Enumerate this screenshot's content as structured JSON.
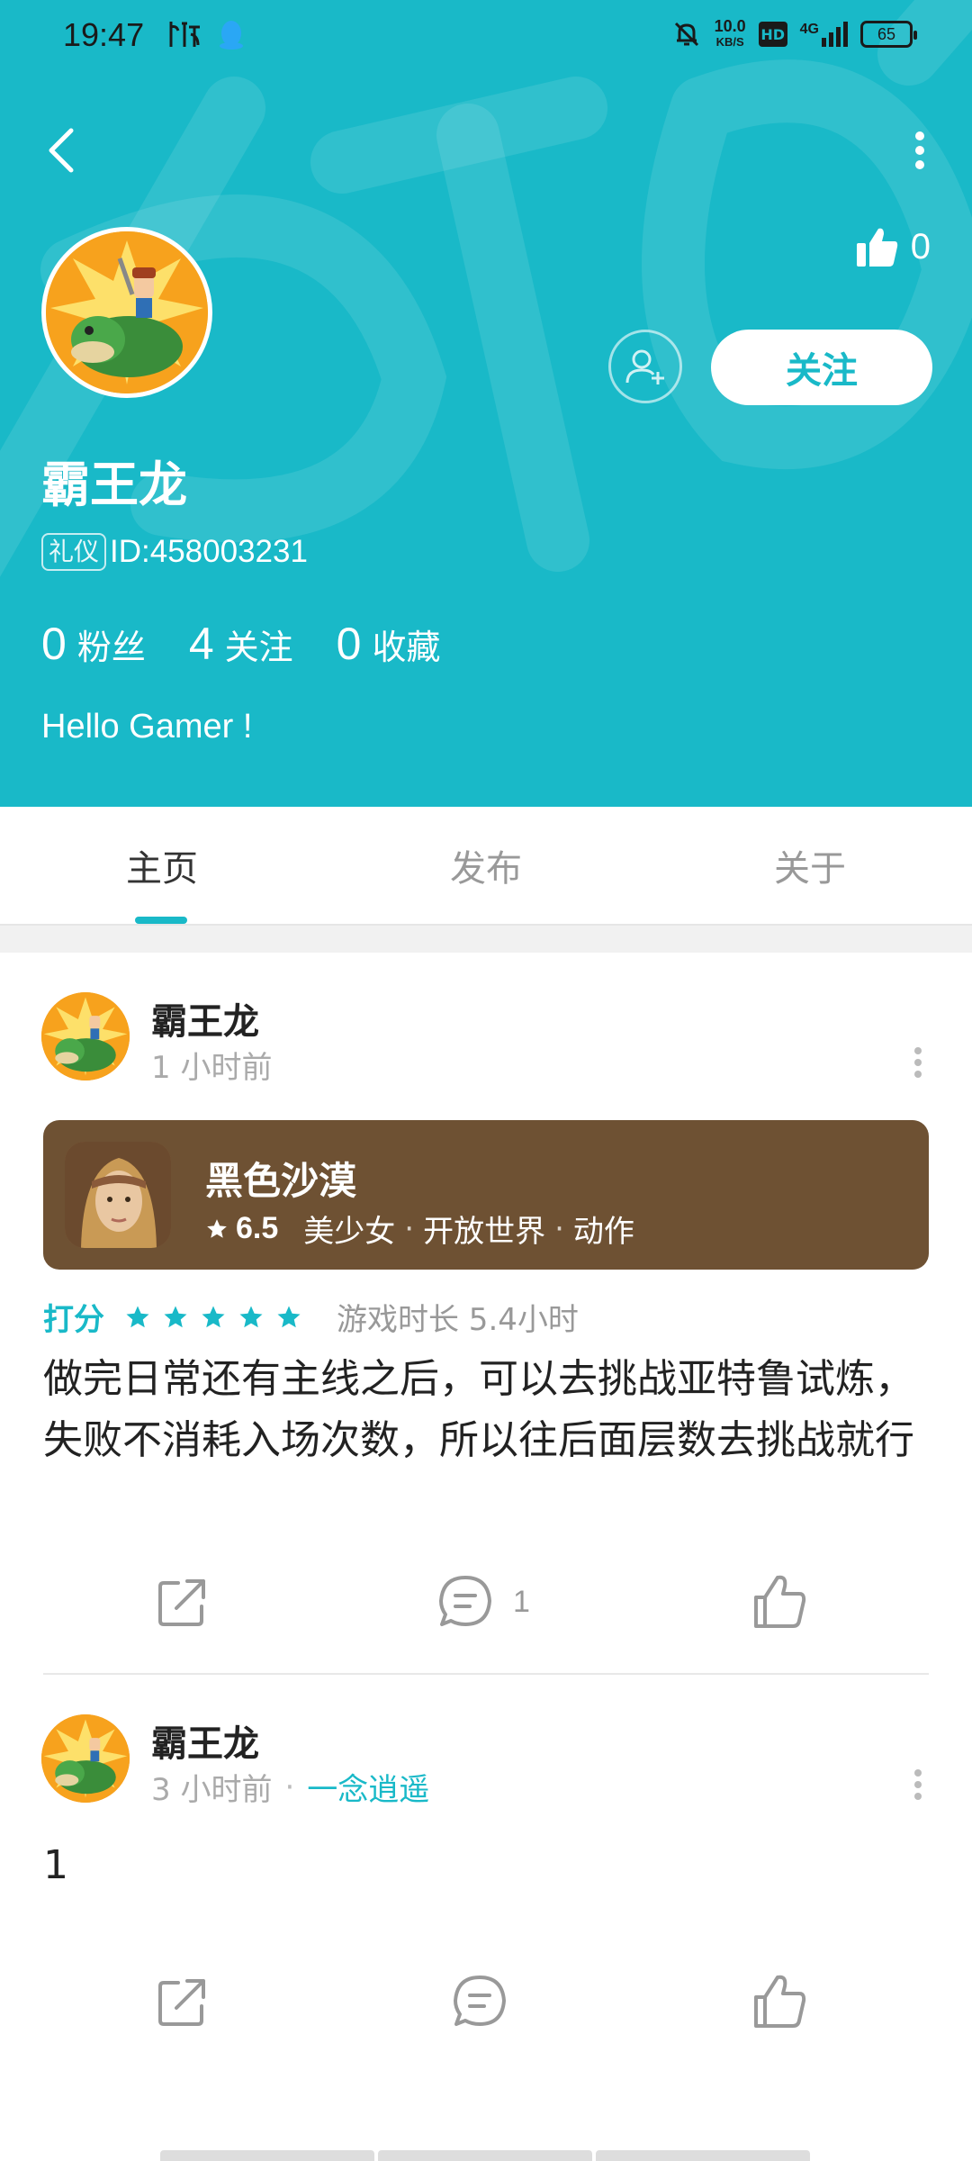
{
  "status_bar": {
    "time": "19:47",
    "net_speed_value": "10.0",
    "net_speed_unit": "KB/S",
    "hd_label": "HD",
    "network": "4G",
    "battery": "65"
  },
  "profile": {
    "name": "霸王龙",
    "badge": "礼仪",
    "id_text": "ID:458003231",
    "likes": "0",
    "follow_label": "关注",
    "bio": "Hello Gamer !",
    "stats": [
      {
        "num": "0",
        "label": "粉丝"
      },
      {
        "num": "4",
        "label": "关注"
      },
      {
        "num": "0",
        "label": "收藏"
      }
    ]
  },
  "tabs": [
    {
      "label": "主页",
      "active": true
    },
    {
      "label": "发布",
      "active": false
    },
    {
      "label": "关于",
      "active": false
    }
  ],
  "posts": [
    {
      "author": "霸王龙",
      "time": "1 小时前",
      "game": {
        "title": "黑色沙漠",
        "score": "6.5",
        "tags": [
          "美少女",
          "开放世界",
          "动作"
        ]
      },
      "rating_label": "打分",
      "rating_stars": 5,
      "playtime": "游戏时长 5.4小时",
      "text": "做完日常还有主线之后，可以去挑战亚特鲁试炼，失败不消耗入场次数，所以往后面层数去挑战就行",
      "comment_count": "1"
    },
    {
      "author": "霸王龙",
      "time": "3 小时前",
      "reply_to": "一念逍遥",
      "text": "1"
    }
  ],
  "colors": {
    "accent": "#19b9c8",
    "game_card": "#6e5133"
  }
}
